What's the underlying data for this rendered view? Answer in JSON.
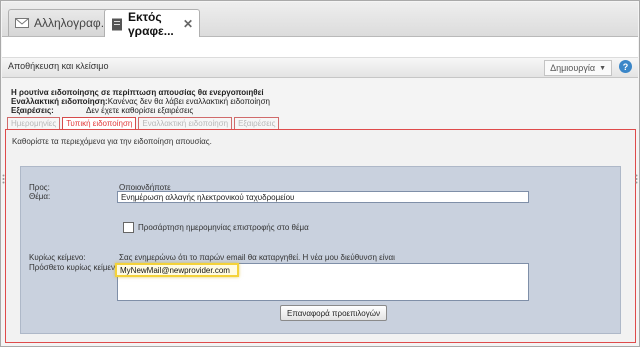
{
  "tabs": [
    {
      "label": "Αλληλογραφ...",
      "icon": "mail-icon",
      "active": false
    },
    {
      "label": "Εκτός γραφε...",
      "icon": "document-icon",
      "active": true
    }
  ],
  "toolbar": {
    "save_close_label": "Αποθήκευση και κλείσιμο",
    "create_label": "Δημιουργία",
    "help_icon": "help-icon"
  },
  "info": {
    "line1": "Η ρουτίνα ειδοποίησης σε περίπτωση απουσίας θα ενεργοποιηθεί",
    "alt_key": "Εναλλακτική ειδοποίηση:",
    "alt_value": "Κανένας δεν θα λάβει εναλλακτική ειδοποίηση",
    "exc_key": "Εξαιρέσεις:",
    "exc_value": "Δεν έχετε καθορίσει εξαιρέσεις"
  },
  "subtabs": [
    "Ημερομηνίες",
    "Τυπική ειδοποίηση",
    "Εναλλακτική ειδοποίηση",
    "Εξαιρέσεις"
  ],
  "panel": {
    "intro": "Καθορίστε τα περιεχόμενα για την ειδοποίηση απουσίας.",
    "to_label": "Προς:",
    "to_value": "Οποιονδήποτε",
    "subject_label": "Θέμα:",
    "subject_value": "Ενημέρωση αλλαγής ηλεκτρονικού ταχυδρομείου",
    "append_date_label": "Προσάρτηση ημερομηνίας επιστροφής στο θέμα",
    "body_label": "Κυρίως κείμενο:",
    "body_value": "Σας ενημερώνω ότι το παρών email θα καταργηθεί. Η νέα μου διεύθυνση είναι",
    "add_body_label": "Πρόσθετο κυρίως κείμενο:",
    "add_body_value": "MyNewMail@newprovider.com",
    "reset_label": "Επαναφορά προεπιλογών"
  },
  "colors": {
    "accent_red": "#df4b4b",
    "highlight": "#f4d23a",
    "inner_bg": "#c9d1de"
  }
}
